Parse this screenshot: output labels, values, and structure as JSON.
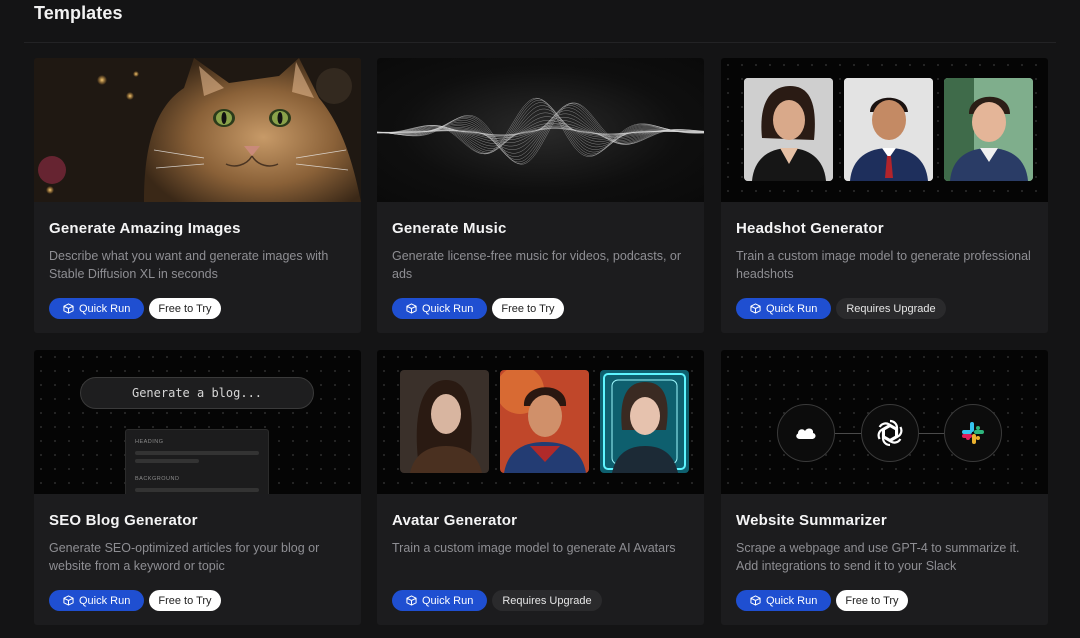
{
  "page": {
    "title": "Templates"
  },
  "buttons": {
    "quick_run": "Quick Run"
  },
  "badges": {
    "free": "Free to Try",
    "upgrade": "Requires Upgrade"
  },
  "colors": {
    "accent": "#1f4fd1",
    "background": "#141415",
    "card": "#1c1c1e"
  },
  "cards": [
    {
      "title": "Generate Amazing Images",
      "description": "Describe what you want and generate images with Stable Diffusion XL in seconds",
      "badge": "Free to Try",
      "hero_icon": "cat-photo"
    },
    {
      "title": "Generate Music",
      "description": "Generate license-free music for videos, podcasts, or ads",
      "badge": "Free to Try",
      "hero_icon": "sound-wave"
    },
    {
      "title": "Headshot Generator",
      "description": "Train a custom image model to generate professional headshots",
      "badge": "Requires Upgrade",
      "hero_icon": "headshot-photos"
    },
    {
      "title": "SEO Blog Generator",
      "description": "Generate SEO-optimized articles for your blog or website from a keyword or topic",
      "badge": "Free to Try",
      "hero_icon": "blog-input",
      "hero": {
        "input_text": "Generate a blog...",
        "panel_labels": [
          "HEADING",
          "BACKGROUND"
        ]
      }
    },
    {
      "title": "Avatar Generator",
      "description": "Train a custom image model to generate AI Avatars",
      "badge": "Requires Upgrade",
      "hero_icon": "avatar-photos"
    },
    {
      "title": "Website Summarizer",
      "description": "Scrape a webpage and use GPT-4 to summarize it. Add integrations to send it to your Slack",
      "badge": "Free to Try",
      "hero_icon": "integration-flow"
    }
  ]
}
